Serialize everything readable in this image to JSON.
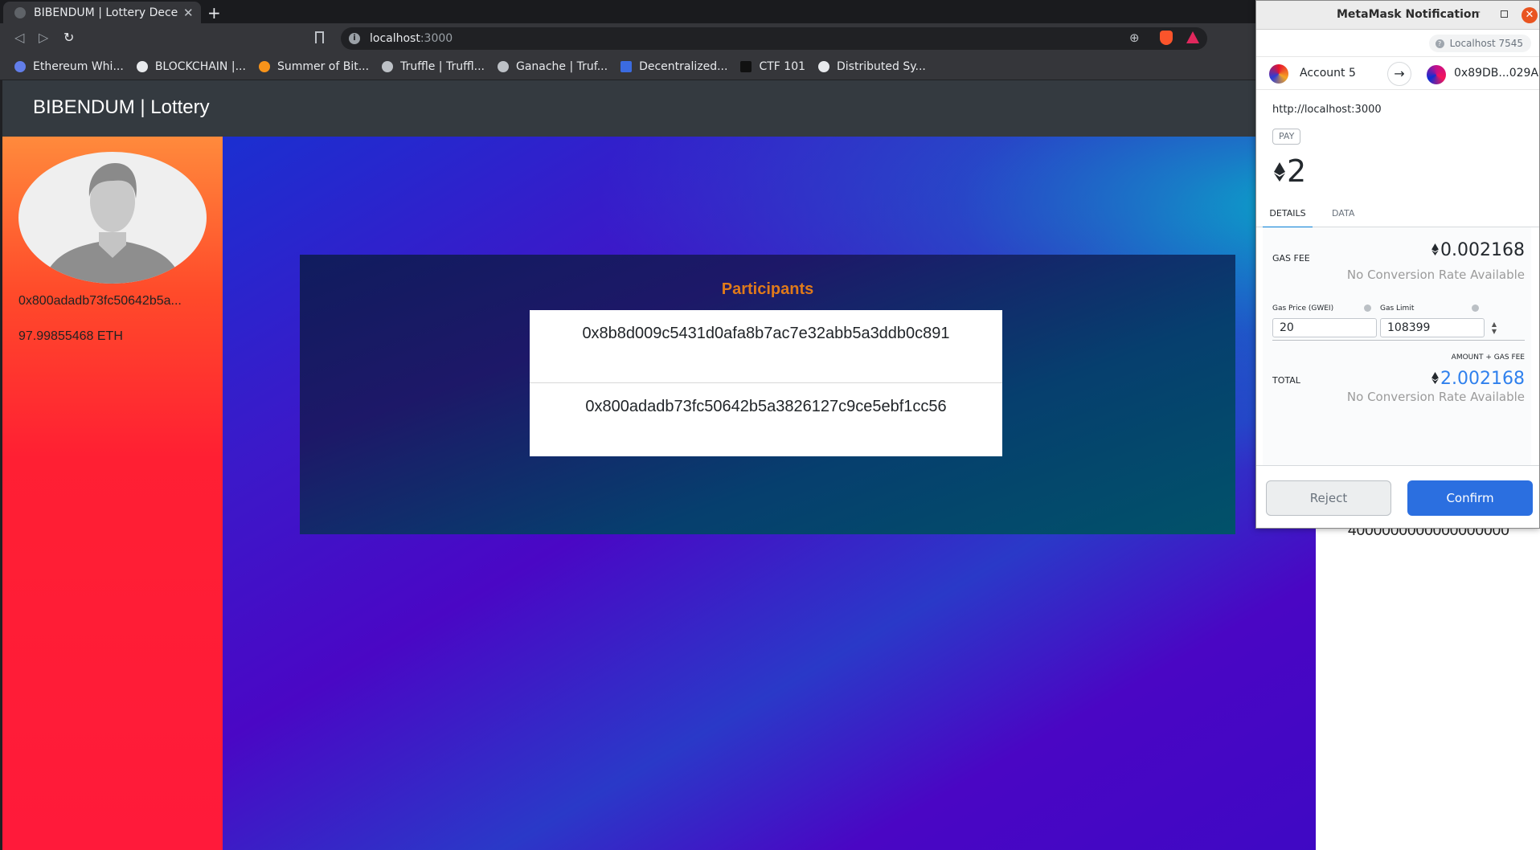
{
  "browser": {
    "tab_title": "BIBENDUM | Lottery Dece",
    "url_host": "localhost",
    "url_port": ":3000",
    "bookmarks": [
      {
        "label": "Ethereum Whi...",
        "color": "#627eea"
      },
      {
        "label": "BLOCKCHAIN |...",
        "color": "#e8eaed"
      },
      {
        "label": "Summer of Bit...",
        "color": "#f7931a"
      },
      {
        "label": "Truffle | Truffl...",
        "color": "#bdc1c6"
      },
      {
        "label": "Ganache | Truf...",
        "color": "#bdc1c6"
      },
      {
        "label": "Decentralized...",
        "color": "#3b6be0"
      },
      {
        "label": "CTF 101",
        "color": "#202124"
      },
      {
        "label": "Distributed Sy...",
        "color": "#e8eaed"
      }
    ]
  },
  "app": {
    "brand": "BIBENDUM | Lottery",
    "account_address": "0x800adadb73fc50642b5a...",
    "account_balance": "97.99855468 ETH",
    "participants_title": "Participants",
    "participants": [
      "0x8b8d009c5431d0afa8b7ac7e32abb5a3ddb0c891",
      "0x800adadb73fc50642b5a3826127c9ce5ebf1cc56"
    ],
    "side_value": "4000000000000000000"
  },
  "metamask": {
    "window_title": "MetaMask Notification",
    "network": "Localhost 7545",
    "from_account": "Account 5",
    "to_address": "0x89DB...029A",
    "origin": "http://localhost:3000",
    "tx_type": "PAY",
    "amount": "2",
    "tabs": [
      "DETAILS",
      "DATA"
    ],
    "gas_fee_label": "GAS FEE",
    "gas_fee_value": "0.002168",
    "no_conversion": "No Conversion Rate Available",
    "gas_price_label": "Gas Price (GWEI)",
    "gas_price_value": "20",
    "gas_limit_label": "Gas Limit",
    "gas_limit_value": "108399",
    "amount_gas_label": "AMOUNT + GAS FEE",
    "total_label": "TOTAL",
    "total_value": "2.002168",
    "reject_label": "Reject",
    "confirm_label": "Confirm",
    "colors": {
      "confirm": "#2b6fe0",
      "total": "#2f80ed"
    }
  }
}
